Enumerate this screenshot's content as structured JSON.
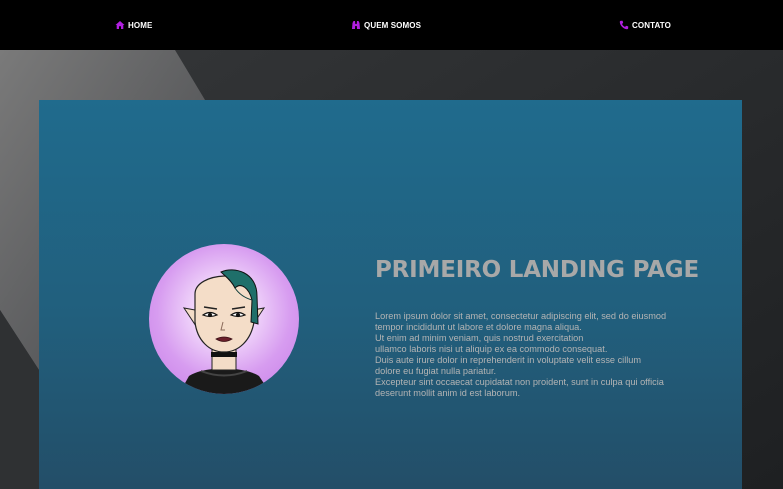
{
  "nav": {
    "items": [
      {
        "label": "HOME",
        "icon": "home-icon"
      },
      {
        "label": "QUEM SOMOS",
        "icon": "binoculars-icon"
      },
      {
        "label": "CONTATO",
        "icon": "phone-icon"
      }
    ],
    "accent": "#b01fe0"
  },
  "hero": {
    "title": "PRIMEIRO LANDING PAGE",
    "paragraph_lines": [
      "Lorem ipsum dolor sit amet, consectetur adipiscing elit, sed do eiusmod",
      "tempor incididunt ut labore et dolore magna aliqua.",
      "Ut enim ad minim veniam, quis nostrud exercitation",
      "ullamco laboris nisi ut aliquip ex ea commodo consequat.",
      "Duis aute irure dolor in reprehenderit in voluptate velit esse cillum",
      "dolore eu fugiat nulla pariatur.",
      "Excepteur sint occaecat cupidatat non proident, sunt in culpa qui officia",
      "deserunt mollit anim id est laborum."
    ],
    "image": "avatar-illustration"
  },
  "colors": {
    "nav_bg": "#000000",
    "hero_bg": "#206b8d",
    "title": "#a8a8a8",
    "text": "#b4b4b4"
  }
}
